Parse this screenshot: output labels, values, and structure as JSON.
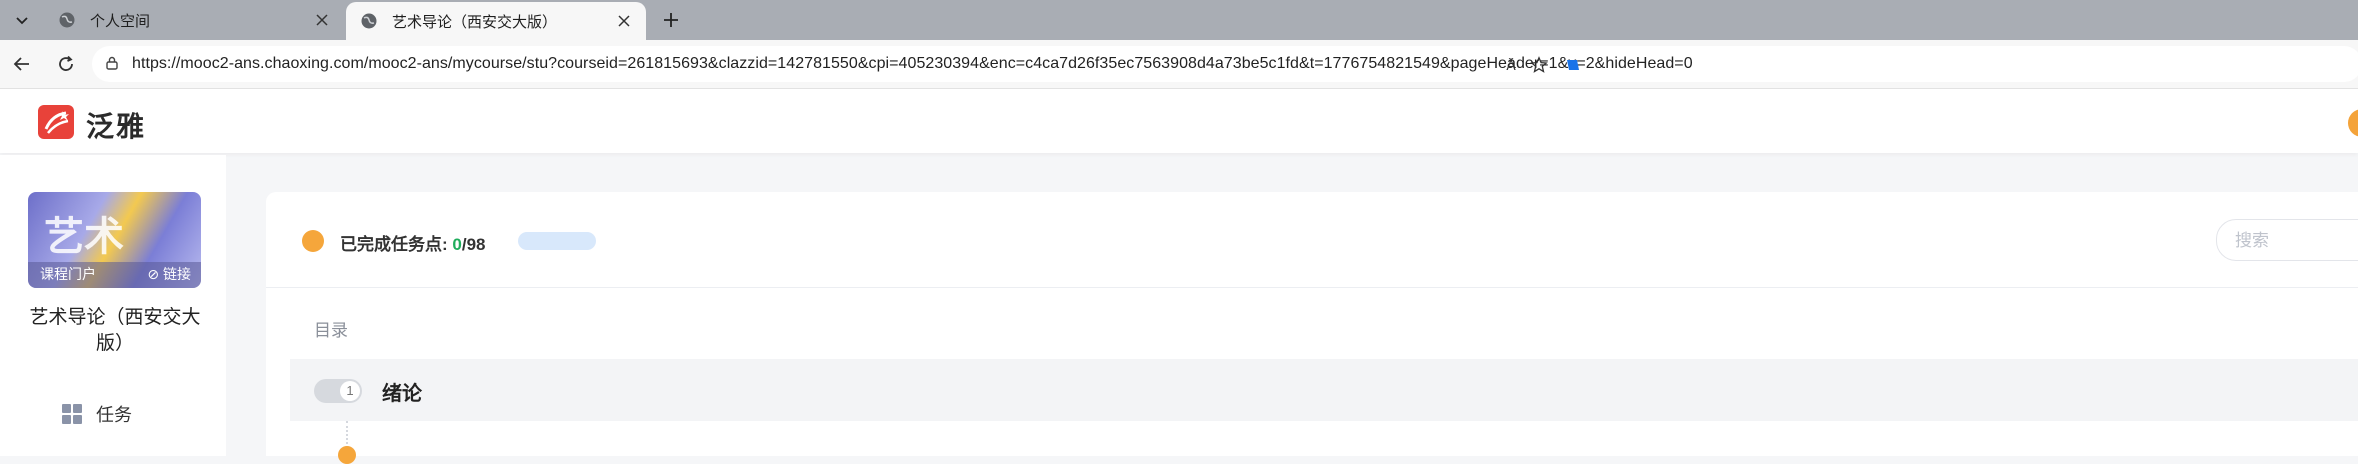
{
  "browser": {
    "tabs": [
      {
        "title": "个人空间",
        "active": false
      },
      {
        "title": "艺术导论（西安交大版）",
        "active": true
      }
    ],
    "url": "https://mooc2-ans.chaoxing.com/mooc2-ans/mycourse/stu?courseid=261815693&clazzid=142781550&cpi=405230394&enc=c4ca7d26f35ec7563908d4a73be5c1fd&t=1776754821549&pageHeader=1&v=2&hideHead=0",
    "read_aloud_label": "Ă"
  },
  "site": {
    "brand": "泛雅",
    "brand_color": "#e8423a"
  },
  "sidebar": {
    "cover": {
      "art_text": "艺术",
      "portal_label": "课程门户",
      "link_label": "⊘ 链接"
    },
    "course_title": "艺术导论（西安交大版）",
    "menu": [
      {
        "label": "任务",
        "icon": "grid-icon"
      }
    ]
  },
  "main": {
    "progress": {
      "label": "已完成任务点: ",
      "done": "0",
      "total": "/98",
      "fraction": 0.0
    },
    "search": {
      "placeholder": "搜索"
    },
    "catalog_label": "目录",
    "chapters": [
      {
        "number": "1",
        "title": "绪论"
      }
    ]
  }
}
